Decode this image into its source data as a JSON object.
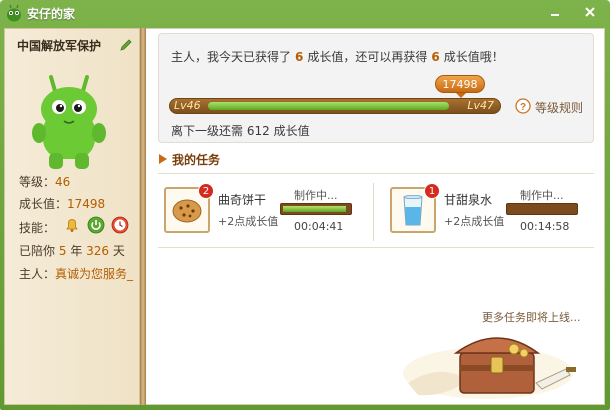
{
  "titlebar": {
    "title": "安仔的家",
    "icons": {
      "app": "green-pet-icon",
      "minimize": "minimize-icon",
      "close": "close-icon"
    }
  },
  "pet": {
    "name": "中国解放军保护",
    "edit_icon": "pencil-icon",
    "level_label": "等级：",
    "level": "46",
    "growth_label": "成长值：",
    "growth": "17498",
    "skills_label": "技能：",
    "skills": [
      "bell-icon",
      "power-icon",
      "clock-icon"
    ],
    "days_prefix": "已陪你",
    "years": "5",
    "years_unit": "年",
    "days": "326",
    "days_unit": "天",
    "owner_label": "主人：",
    "owner": "真诚为您服务_"
  },
  "status": {
    "msg_prefix": "主人，我今天已获得了",
    "today_gained": "6",
    "msg_middle": "成长值，还可以再获得",
    "remaining_today": "6",
    "msg_suffix": "成长值哦！",
    "bubble_value": "17498",
    "level_from": "Lv46",
    "level_to": "Lv47",
    "level_progress_fraction": 0.95,
    "rules_label": "等级规则",
    "remain_prefix": "离下一级还需",
    "remain_value": "612",
    "remain_suffix": "成长值"
  },
  "tasks": {
    "title": "我的任务",
    "items": [
      {
        "name": "曲奇饼干",
        "reward": "+2点成长值",
        "status": "制作中...",
        "time": "00:04:41",
        "count": "2",
        "progress_fraction": 0.95,
        "icon": "cookie-icon"
      },
      {
        "name": "甘甜泉水",
        "reward": "+2点成长值",
        "status": "制作中...",
        "time": "00:14:58",
        "count": "1",
        "progress_fraction": 0.0,
        "icon": "water-glass-icon"
      }
    ],
    "more_label": "更多任务即将上线..."
  },
  "colors": {
    "accent_green": "#6aa83a",
    "level_text": "#b35d00",
    "brown": "#7b4a1d"
  }
}
